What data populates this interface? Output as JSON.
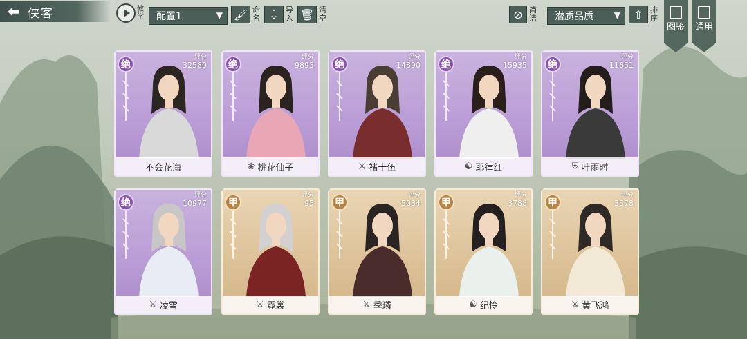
{
  "header": {
    "back_icon": "back-arrow-icon",
    "title": "侠客",
    "tutorial_label": "教学",
    "config_select": "配置1",
    "rename_label": "命名",
    "import_label": "导入",
    "clear_label": "清空",
    "simplify_label": "简洁",
    "quality_select": "潜质品质",
    "sort_label": "排序",
    "gallery_label": "图鉴",
    "general_label": "通用"
  },
  "colors": {
    "jue": "#b99bd5",
    "jia": "#dcc198",
    "toolbar": "#4b5f58"
  },
  "heroes": [
    {
      "grade": "绝",
      "score_label": "评分",
      "score": "32580",
      "name": "不会花海",
      "icon": ""
    },
    {
      "grade": "绝",
      "score_label": "评分",
      "score": "9893",
      "name": "桃花仙子",
      "icon": "lotus-icon"
    },
    {
      "grade": "绝",
      "score_label": "评分",
      "score": "14890",
      "name": "褚十伍",
      "icon": "sword-icon"
    },
    {
      "grade": "绝",
      "score_label": "评分",
      "score": "15935",
      "name": "耶律红",
      "icon": "taiji-icon"
    },
    {
      "grade": "绝",
      "score_label": "评分",
      "score": "11651",
      "name": "叶雨时",
      "icon": "shield-icon"
    },
    {
      "grade": "绝",
      "score_label": "评分",
      "score": "10977",
      "name": "凌雪",
      "icon": "sword-icon"
    },
    {
      "grade": "甲",
      "score_label": "评分",
      "score": "95",
      "name": "霓裳",
      "icon": "sword-icon"
    },
    {
      "grade": "甲",
      "score_label": "评分",
      "score": "5034",
      "name": "季璘",
      "icon": "sword-icon"
    },
    {
      "grade": "甲",
      "score_label": "评分",
      "score": "3788",
      "name": "纪怜",
      "icon": "taiji-icon"
    },
    {
      "grade": "甲",
      "score_label": "评分",
      "score": "3578",
      "name": "黄飞鸿",
      "icon": "sword-icon"
    }
  ]
}
